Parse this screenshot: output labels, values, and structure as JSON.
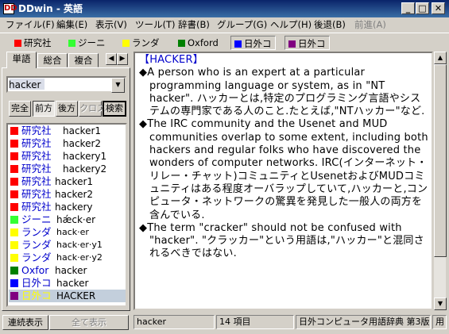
{
  "window": {
    "title": "DDwin - 英語",
    "app_icon": "DD",
    "minimize": "_",
    "maximize": "□",
    "close": "✕"
  },
  "menu": [
    "ファイル(F)",
    "編集(E)",
    "表示(V)",
    "ツール(T)",
    "辞書(B)",
    "グループ(G)",
    "ヘルプ(H)",
    "後退(B)",
    "前進(A)"
  ],
  "dictionaries": [
    {
      "label": "研究社",
      "color": "#ff0000"
    },
    {
      "label": "ジーニ",
      "color": "#33ff33"
    },
    {
      "label": "ランダ",
      "color": "#ffff00"
    },
    {
      "label": "Oxford",
      "color": "#008000"
    },
    {
      "label": "日外コ",
      "color": "#0000ff"
    },
    {
      "label": "日外コ",
      "color": "#800080"
    }
  ],
  "tabs": [
    "単語",
    "総合",
    "複合"
  ],
  "tab_arrows": {
    "left": "◀",
    "right": "▶"
  },
  "search": {
    "value": "hacker",
    "dropdown": "▼"
  },
  "modes": [
    "完全",
    "前方",
    "後方",
    "クロス",
    "検索"
  ],
  "results": [
    {
      "dict": "研究社",
      "word": "hacker1",
      "color": "#ff0000"
    },
    {
      "dict": "研究社",
      "word": "hacker2",
      "color": "#ff0000"
    },
    {
      "dict": "研究社",
      "word": "hackery1",
      "color": "#ff0000"
    },
    {
      "dict": "研究社",
      "word": "hackery2",
      "color": "#ff0000"
    },
    {
      "dict": "研究社",
      "word": "hacker1",
      "color": "#ff0000"
    },
    {
      "dict": "研究社",
      "word": "hacker2",
      "color": "#ff0000"
    },
    {
      "dict": "研究社",
      "word": "hackery",
      "color": "#ff0000"
    },
    {
      "dict": "ジーニ",
      "word": "hǽck·er",
      "color": "#33ff33"
    },
    {
      "dict": "ランダ",
      "word": "hack·er",
      "color": "#ffff00"
    },
    {
      "dict": "ランダ",
      "word": "hack·er·y1",
      "color": "#ffff00"
    },
    {
      "dict": "ランダ",
      "word": "hack·er·y2",
      "color": "#ffff00"
    },
    {
      "dict": "Oxfor",
      "word": "hacker",
      "color": "#008000"
    },
    {
      "dict": "日外コ",
      "word": "hacker",
      "color": "#0000ff"
    },
    {
      "dict": "日外コ",
      "word": "HACKER",
      "color": "#800080"
    }
  ],
  "bottom_buttons": {
    "continuous": "連続表示",
    "show_all": "全て表示"
  },
  "content": {
    "heading": "【HACKER】",
    "paragraphs": [
      "◆A person who is an expert at a particular programming language or system, as in \"NT hacker\". ハッカーとは,特定のプログラミング言語やシステムの専門家である人のこと.たとえば,\"NTハッカー\"など.",
      "◆The IRC community and the Usenet and MUD communities overlap to some extent, including both hackers and regular folks who have discovered the wonders of computer networks. IRC(インターネット・リレー・チャット)コミュニティとUsenetおよびMUDコミュニティはある程度オーバラップしていて,ハッカーと,コンピュータ・ネットワークの驚異を発見した一般人の両方を含んでいる.",
      "◆The term \"cracker\" should not be confused with \"hacker\". \"クラッカー\"という用語は,\"ハッカー\"と混同されるべきではない."
    ]
  },
  "scroll": {
    "up": "▲",
    "down": "▼"
  },
  "status": {
    "word": "hacker",
    "count": "14 項目",
    "dictionary": "日外コンピュータ用語辞典  第3版",
    "extra": "用"
  }
}
